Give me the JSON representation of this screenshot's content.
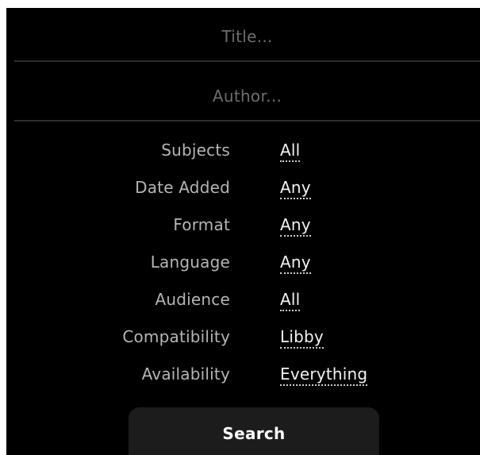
{
  "search": {
    "title_placeholder": "Title...",
    "title_value": "",
    "author_placeholder": "Author...",
    "author_value": ""
  },
  "filters": [
    {
      "label": "Subjects",
      "value": "All"
    },
    {
      "label": "Date Added",
      "value": "Any"
    },
    {
      "label": "Format",
      "value": "Any"
    },
    {
      "label": "Language",
      "value": "Any"
    },
    {
      "label": "Audience",
      "value": "All"
    },
    {
      "label": "Compatibility",
      "value": "Libby"
    },
    {
      "label": "Availability",
      "value": "Everything"
    }
  ],
  "actions": {
    "search_label": "Search"
  },
  "colors": {
    "background": "#000000",
    "label_text": "#b5b5b5",
    "value_text": "#f2f2f2",
    "placeholder_text": "#6e6e6e",
    "divider": "#2e2e2e",
    "button_background": "#1c1c1c",
    "button_text": "#ffffff"
  }
}
